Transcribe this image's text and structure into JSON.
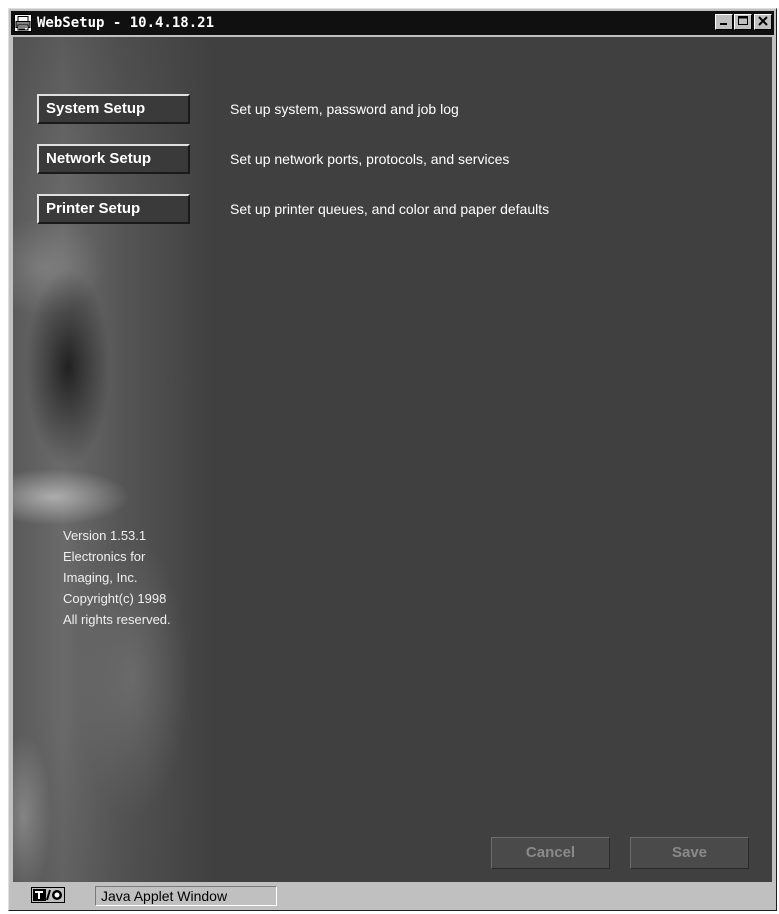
{
  "window": {
    "title": "WebSetup - 10.4.18.21",
    "icon": "printer-icon",
    "controls": [
      "minimize-icon",
      "maximize-icon",
      "close-icon"
    ]
  },
  "nav": [
    {
      "label": "System Setup",
      "description": "Set up system, password and job log"
    },
    {
      "label": "Network Setup",
      "description": "Set up network ports, protocols, and services"
    },
    {
      "label": "Printer Setup",
      "description": "Set up printer queues, and color and paper defaults"
    }
  ],
  "info": {
    "line1": "Version 1.53.1",
    "line2": "Electronics for",
    "line3": "Imaging, Inc.",
    "line4": "Copyright(c) 1998",
    "line5": "All rights reserved."
  },
  "actions": {
    "cancel": "Cancel",
    "save": "Save"
  },
  "status": {
    "text": "Java Applet Window",
    "icon": "java-applet-icon"
  },
  "colors": {
    "background": "#404040",
    "titlebar": "#101010",
    "text": "#ffffff",
    "disabled_text": "#8a8a8a"
  }
}
